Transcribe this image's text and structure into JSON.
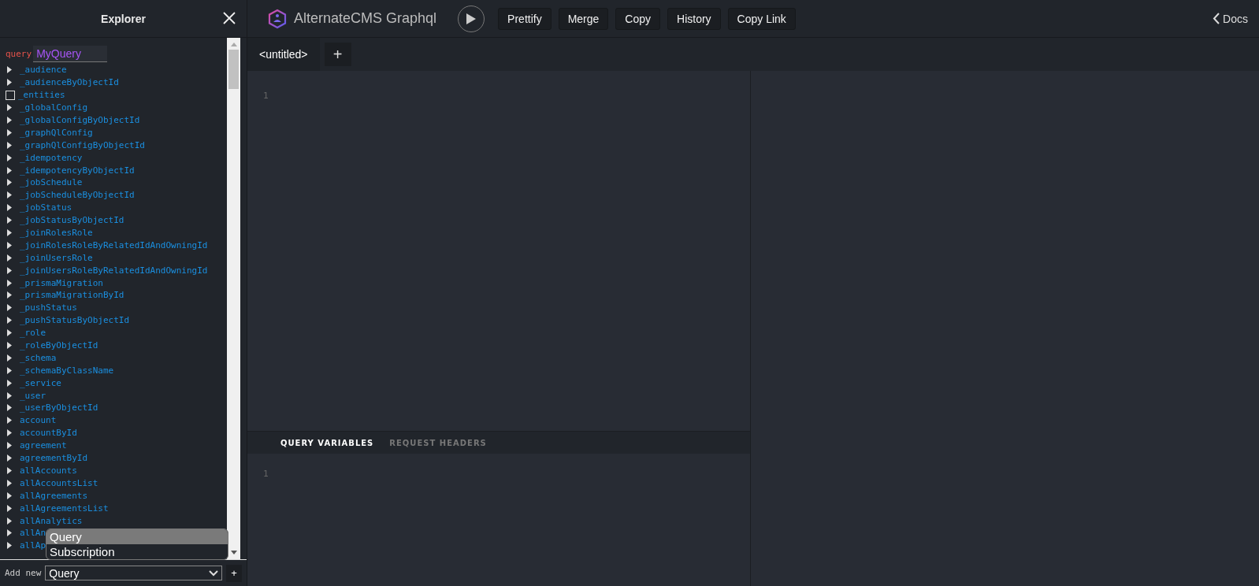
{
  "explorer": {
    "title": "Explorer",
    "operation": {
      "keyword": "query",
      "name": "MyQuery"
    },
    "fields": [
      {
        "name": "_audience",
        "kind": "field"
      },
      {
        "name": "_audienceByObjectId",
        "kind": "field"
      },
      {
        "name": "_entities",
        "kind": "leaf",
        "checked": false
      },
      {
        "name": "_globalConfig",
        "kind": "field"
      },
      {
        "name": "_globalConfigByObjectId",
        "kind": "field"
      },
      {
        "name": "_graphQlConfig",
        "kind": "field"
      },
      {
        "name": "_graphQlConfigByObjectId",
        "kind": "field"
      },
      {
        "name": "_idempotency",
        "kind": "field"
      },
      {
        "name": "_idempotencyByObjectId",
        "kind": "field"
      },
      {
        "name": "_jobSchedule",
        "kind": "field"
      },
      {
        "name": "_jobScheduleByObjectId",
        "kind": "field"
      },
      {
        "name": "_jobStatus",
        "kind": "field"
      },
      {
        "name": "_jobStatusByObjectId",
        "kind": "field"
      },
      {
        "name": "_joinRolesRole",
        "kind": "field"
      },
      {
        "name": "_joinRolesRoleByRelatedIdAndOwningId",
        "kind": "field"
      },
      {
        "name": "_joinUsersRole",
        "kind": "field"
      },
      {
        "name": "_joinUsersRoleByRelatedIdAndOwningId",
        "kind": "field"
      },
      {
        "name": "_prismaMigration",
        "kind": "field"
      },
      {
        "name": "_prismaMigrationById",
        "kind": "field"
      },
      {
        "name": "_pushStatus",
        "kind": "field"
      },
      {
        "name": "_pushStatusByObjectId",
        "kind": "field"
      },
      {
        "name": "_role",
        "kind": "field"
      },
      {
        "name": "_roleByObjectId",
        "kind": "field"
      },
      {
        "name": "_schema",
        "kind": "field"
      },
      {
        "name": "_schemaByClassName",
        "kind": "field"
      },
      {
        "name": "_service",
        "kind": "field"
      },
      {
        "name": "_user",
        "kind": "field"
      },
      {
        "name": "_userByObjectId",
        "kind": "field"
      },
      {
        "name": "account",
        "kind": "field"
      },
      {
        "name": "accountById",
        "kind": "field"
      },
      {
        "name": "agreement",
        "kind": "field"
      },
      {
        "name": "agreementById",
        "kind": "field"
      },
      {
        "name": "allAccounts",
        "kind": "field"
      },
      {
        "name": "allAccountsList",
        "kind": "field"
      },
      {
        "name": "allAgreements",
        "kind": "field"
      },
      {
        "name": "allAgreementsList",
        "kind": "field"
      },
      {
        "name": "allAnalytics",
        "kind": "field"
      },
      {
        "name": "allAn",
        "kind": "field"
      },
      {
        "name": "allAp",
        "kind": "field"
      }
    ],
    "add_new": {
      "label": "Add new",
      "value": "Query",
      "button": "+"
    },
    "dropdown_options": [
      {
        "label": "Query",
        "selected": true
      },
      {
        "label": "Subscription",
        "selected": false
      }
    ]
  },
  "toolbar": {
    "title": "AlternateCMS Graphql",
    "buttons": [
      "Prettify",
      "Merge",
      "Copy",
      "History",
      "Copy Link"
    ],
    "docs": "Docs"
  },
  "tabs": [
    {
      "label": "<untitled>",
      "selected": true
    }
  ],
  "add_tab": "+",
  "editor": {
    "line_numbers": [
      "1"
    ]
  },
  "variables_tabs": [
    {
      "label": "QUERY VARIABLES",
      "selected": true
    },
    {
      "label": "REQUEST HEADERS",
      "selected": false
    }
  ],
  "variables_editor": {
    "line_numbers": [
      "1"
    ]
  }
}
